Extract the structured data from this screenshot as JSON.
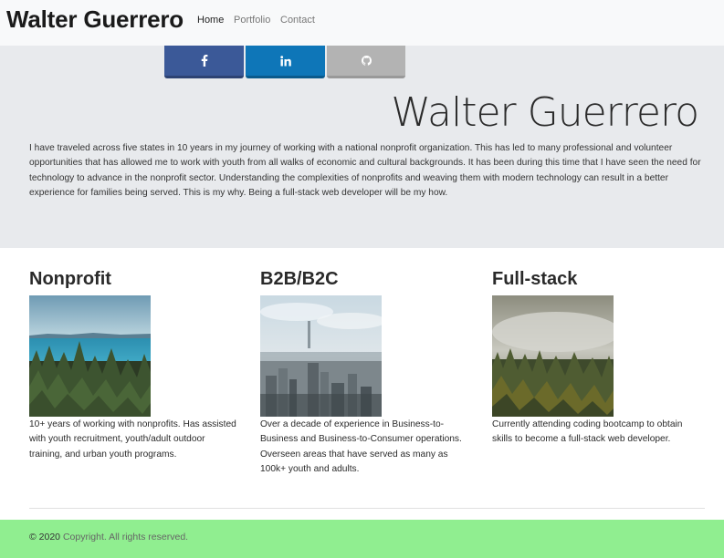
{
  "navbar": {
    "brand": "Walter Guerrero",
    "links": [
      {
        "label": "Home",
        "active": true
      },
      {
        "label": "Portfolio",
        "active": false
      },
      {
        "label": "Contact",
        "active": false
      }
    ]
  },
  "social": [
    {
      "name": "facebook",
      "icon": "facebook-icon",
      "color": "#3b5998"
    },
    {
      "name": "linkedin",
      "icon": "linkedin-icon",
      "color": "#0e76b8"
    },
    {
      "name": "github",
      "icon": "github-icon",
      "color": "#b3b3b3"
    }
  ],
  "hero": {
    "title": "Walter Guerrero",
    "text": "I have traveled across five states in 10 years in my journey of working with a national nonprofit organization. This has led to many professional and volunteer opportunities that has allowed me to work with youth from all walks of economic and cultural backgrounds. It has been during this time that I have seen the need for technology to advance in the nonprofit sector. Understanding the complexities of nonprofits and weaving them with modern technology can result in a better experience for families being served. This is my why. Being a full-stack web developer will be my how."
  },
  "columns": [
    {
      "heading": "Nonprofit",
      "image": "lake-forest-photo",
      "text": "10+ years of working with nonprofits. Has assisted with youth recruitment, youth/adult outdoor training, and urban youth programs."
    },
    {
      "heading": "B2B/B2C",
      "image": "city-skyline-photo",
      "text": "Over a decade of experience in Business-to-Business and Business-to-Consumer operations. Overseen areas that have served as many as 100k+ youth and adults."
    },
    {
      "heading": "Full-stack",
      "image": "misty-forest-photo",
      "text": "Currently attending coding bootcamp to obtain skills to become a full-stack web developer."
    }
  ],
  "footer": {
    "copyright": "© 2020",
    "rest": "Copyright. All rights reserved.",
    "color": "#90ee90"
  }
}
